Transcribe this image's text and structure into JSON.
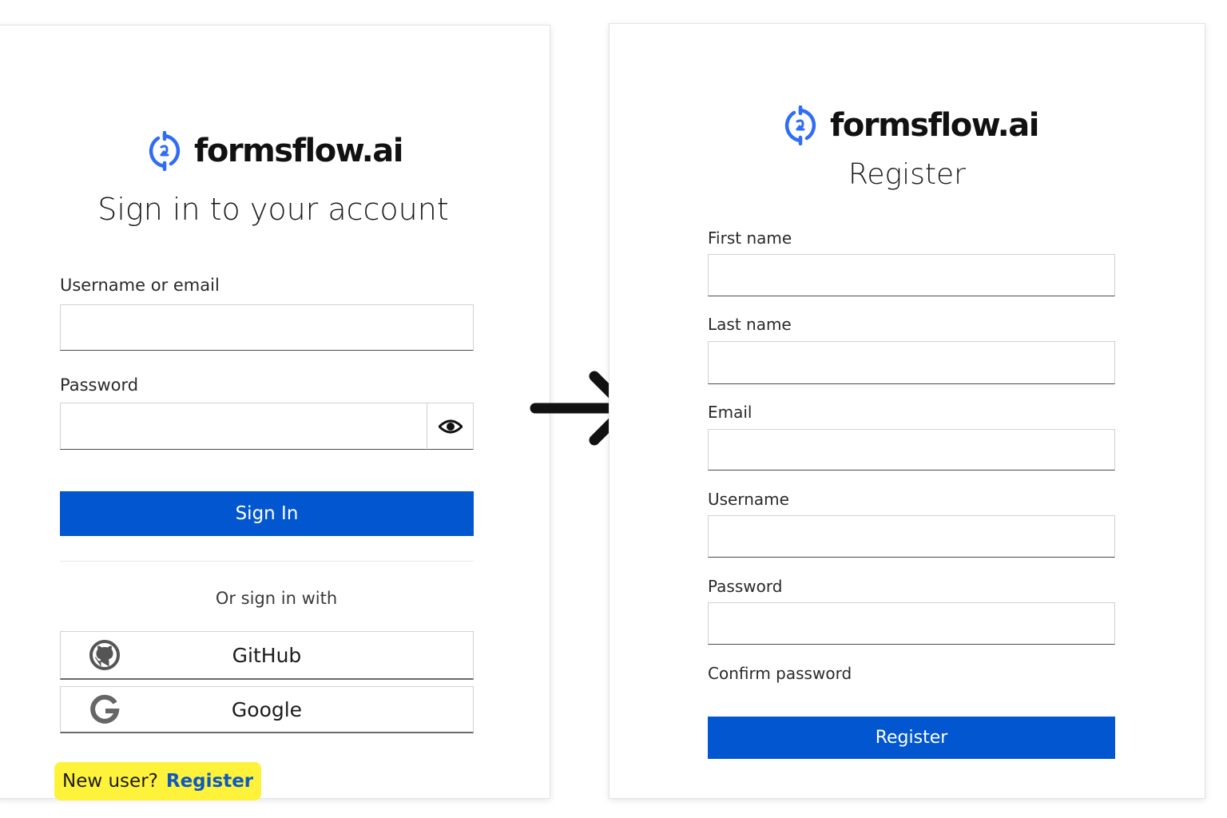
{
  "brand": {
    "name": "formsflow.ai",
    "icon": "formsflow-logo-icon",
    "accent_color": "#2f6df6"
  },
  "signin": {
    "title": "Sign in to your account",
    "username_label": "Username or email",
    "username_value": "",
    "password_label": "Password",
    "password_value": "",
    "show_password_icon": "eye-icon",
    "submit_label": "Sign In",
    "submit_color": "#0257d0",
    "or_text": "Or sign in with",
    "providers": [
      {
        "label": "GitHub",
        "icon": "github-icon"
      },
      {
        "label": "Google",
        "icon": "google-icon"
      }
    ],
    "new_user_text": "New user?",
    "register_link": "Register",
    "highlight_color": "#fff23b"
  },
  "transition": {
    "icon": "arrow-right-icon"
  },
  "register": {
    "title": "Register",
    "fields": [
      {
        "label": "First name",
        "value": ""
      },
      {
        "label": "Last name",
        "value": ""
      },
      {
        "label": "Email",
        "value": ""
      },
      {
        "label": "Username",
        "value": ""
      },
      {
        "label": "Password",
        "value": ""
      }
    ],
    "confirm_password_label": "Confirm password",
    "submit_label": "Register",
    "submit_color": "#0257d0"
  }
}
